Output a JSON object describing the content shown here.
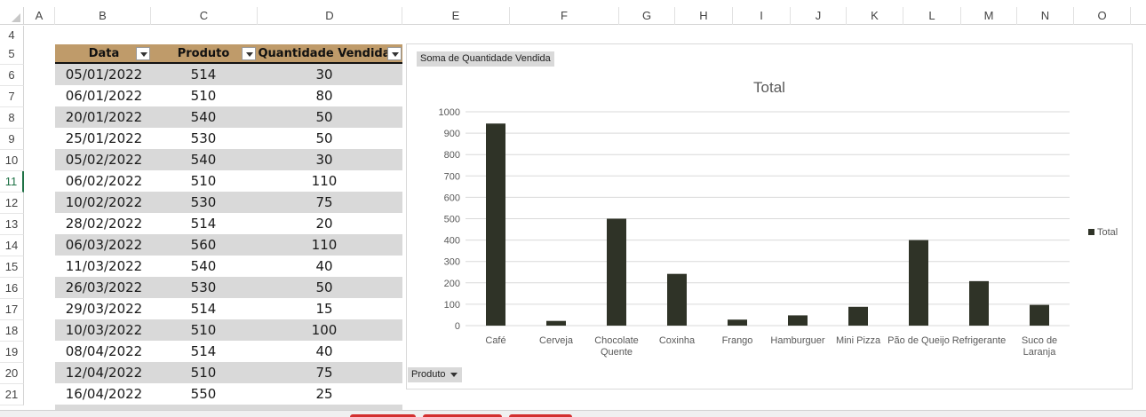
{
  "columns": [
    "A",
    "B",
    "C",
    "D",
    "E",
    "F",
    "G",
    "H",
    "I",
    "J",
    "K",
    "L",
    "M",
    "N",
    "O"
  ],
  "rows": [
    "4",
    "5",
    "6",
    "7",
    "8",
    "9",
    "10",
    "11",
    "12",
    "13",
    "14",
    "15",
    "16",
    "17",
    "18",
    "19",
    "20",
    "21"
  ],
  "active_row": "11",
  "table": {
    "headers": [
      "Data",
      "Produto",
      "Quantidade Vendida"
    ],
    "rows": [
      [
        "05/01/2022",
        "514",
        "30"
      ],
      [
        "06/01/2022",
        "510",
        "80"
      ],
      [
        "20/01/2022",
        "540",
        "50"
      ],
      [
        "25/01/2022",
        "530",
        "50"
      ],
      [
        "05/02/2022",
        "540",
        "30"
      ],
      [
        "06/02/2022",
        "510",
        "110"
      ],
      [
        "10/02/2022",
        "530",
        "75"
      ],
      [
        "28/02/2022",
        "514",
        "20"
      ],
      [
        "06/03/2022",
        "560",
        "110"
      ],
      [
        "11/03/2022",
        "540",
        "40"
      ],
      [
        "26/03/2022",
        "530",
        "50"
      ],
      [
        "29/03/2022",
        "514",
        "15"
      ],
      [
        "10/03/2022",
        "510",
        "100"
      ],
      [
        "08/04/2022",
        "514",
        "40"
      ],
      [
        "12/04/2022",
        "510",
        "75"
      ],
      [
        "16/04/2022",
        "550",
        "25"
      ]
    ]
  },
  "pivot": {
    "series_field": "Soma de Quantidade Vendida",
    "axis_field": "Produto"
  },
  "colors": {
    "bar": "#2f3327",
    "header_fill": "#bf9b6a",
    "band": "#d9d9d9"
  },
  "chart_data": {
    "type": "bar",
    "title": "Total",
    "categories": [
      "Café",
      "Cerveja",
      "Chocolate Quente",
      "Coxinha",
      "Frango",
      "Hamburguer",
      "Mini Pizza",
      "Pão de Queijo",
      "Refrigerante",
      "Suco de Laranja"
    ],
    "series": [
      {
        "name": "Total",
        "values": [
          945,
          22,
          500,
          242,
          28,
          48,
          88,
          400,
          208,
          97
        ]
      }
    ],
    "ylim": [
      0,
      1000
    ],
    "yticks": [
      0,
      100,
      200,
      300,
      400,
      500,
      600,
      700,
      800,
      900,
      1000
    ],
    "grid": true,
    "legend": "right"
  }
}
